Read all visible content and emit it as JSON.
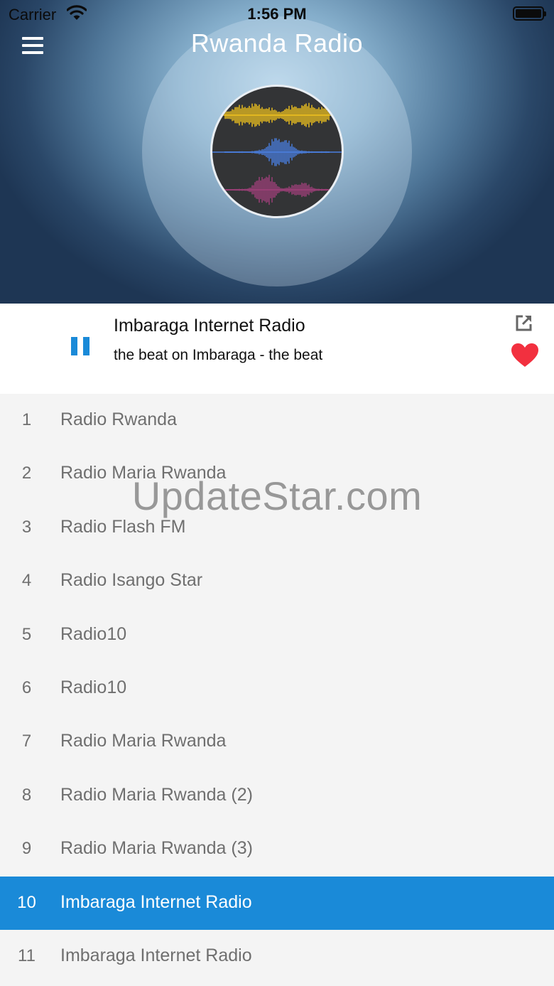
{
  "status_bar": {
    "carrier": "Carrier",
    "time": "1:56 PM"
  },
  "header": {
    "title": "Rwanda Radio"
  },
  "now_playing": {
    "station": "Imbaraga Internet Radio",
    "track": "the beat on Imbaraga - the beat",
    "accent_color": "#1a8ad8",
    "heart_color": "#f2303f"
  },
  "stations": [
    {
      "num": "1",
      "name": "Radio Rwanda"
    },
    {
      "num": "2",
      "name": "Radio Maria Rwanda"
    },
    {
      "num": "3",
      "name": "Radio Flash FM"
    },
    {
      "num": "4",
      "name": "Radio Isango Star"
    },
    {
      "num": "5",
      "name": "Radio10"
    },
    {
      "num": "6",
      "name": "Radio10"
    },
    {
      "num": "7",
      "name": "Radio Maria Rwanda"
    },
    {
      "num": "8",
      "name": "Radio Maria Rwanda (2)"
    },
    {
      "num": "9",
      "name": "Radio Maria Rwanda (3)"
    },
    {
      "num": "10",
      "name": "Imbaraga Internet Radio",
      "selected": true
    },
    {
      "num": "11",
      "name": "Imbaraga Internet Radio"
    }
  ],
  "watermark": "UpdateStar.com"
}
